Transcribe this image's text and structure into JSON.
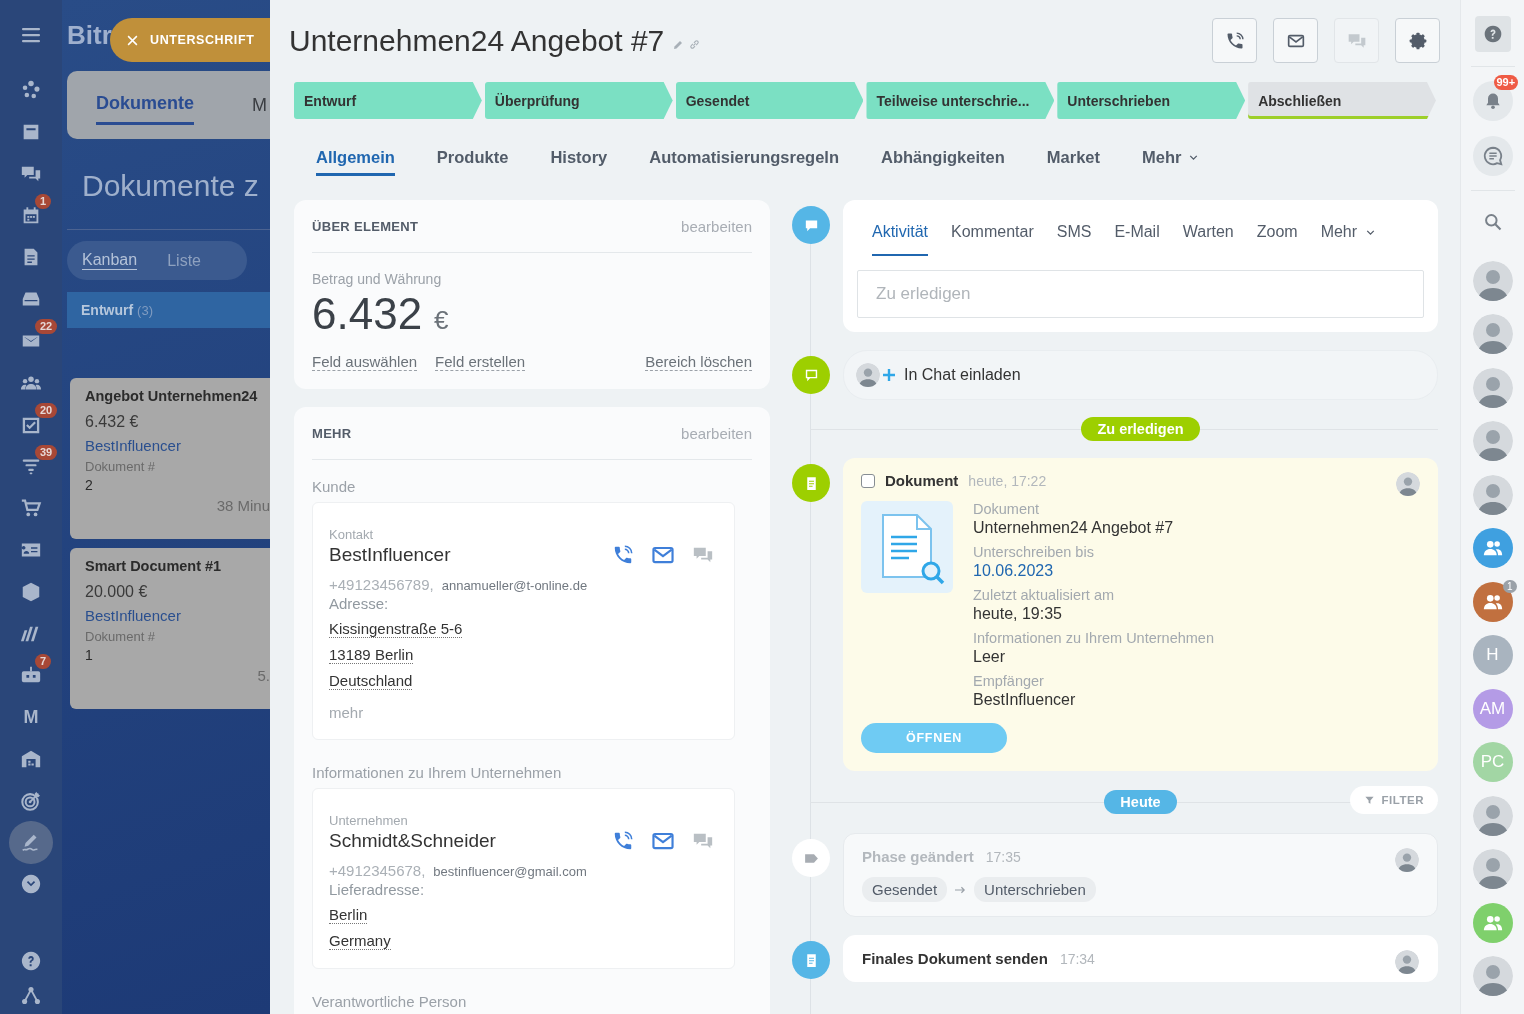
{
  "nav": {
    "items": [
      {
        "selected": false
      },
      {
        "selected": false
      },
      {
        "selected": false
      },
      {
        "badge": "1",
        "selected": false
      },
      {
        "selected": false
      },
      {
        "selected": false
      },
      {
        "badge": "22",
        "selected": false
      },
      {
        "selected": false
      },
      {
        "badge": "20",
        "selected": false
      },
      {
        "badge": "39",
        "selected": false
      },
      {
        "selected": false
      },
      {
        "selected": false
      },
      {
        "selected": false
      },
      {
        "selected": false
      },
      {
        "badge": "7",
        "selected": false
      },
      {
        "label": "M",
        "selected": false
      },
      {
        "selected": false
      },
      {
        "selected": false
      },
      {
        "selected": true
      },
      {
        "selected": false
      }
    ]
  },
  "background": {
    "logo": "Bitr",
    "tabs": [
      {
        "label": "Dokumente",
        "selected": true
      },
      {
        "label": "M",
        "selected": false
      }
    ],
    "title": "Dokumente z",
    "views": [
      {
        "label": "Kanban",
        "selected": true
      },
      {
        "label": "Liste",
        "selected": false
      }
    ],
    "column": {
      "name": "Entwurf",
      "count": "(3)"
    },
    "cards": [
      {
        "title": "Angebot Unternehmen24",
        "amount": "6.432 €",
        "client": "BestInfluencer",
        "field_label": "Dokument #",
        "field_value": "2",
        "time": "38 Minu"
      },
      {
        "title": "Smart Document #1",
        "amount": "20.000 €",
        "client": "BestInfluencer",
        "field_label": "Dokument #",
        "field_value": "1",
        "time": "5."
      }
    ]
  },
  "close_tab": {
    "label": "UNTERSCHRIFT"
  },
  "slider": {
    "title": "Unternehmen24 Angebot #7",
    "header_buttons": [
      {
        "disabled": false
      },
      {
        "disabled": false
      },
      {
        "disabled": true
      },
      {
        "disabled": false
      }
    ],
    "stages": [
      {
        "label": "Entwurf",
        "reached": true
      },
      {
        "label": "Überprüfung",
        "reached": true
      },
      {
        "label": "Gesendet",
        "reached": true
      },
      {
        "label": "Teilweise unterschrie...",
        "reached": true
      },
      {
        "label": "Unterschrieben",
        "reached": true
      },
      {
        "label": "Abschließen",
        "reached": false
      }
    ],
    "tabs": [
      {
        "label": "Allgemein",
        "selected": true,
        "menu": false
      },
      {
        "label": "Produkte",
        "selected": false,
        "menu": false
      },
      {
        "label": "History",
        "selected": false,
        "menu": false
      },
      {
        "label": "Automatisierungsregeln",
        "selected": false,
        "menu": false
      },
      {
        "label": "Abhängigkeiten",
        "selected": false,
        "menu": false
      },
      {
        "label": "Market",
        "selected": false,
        "menu": false
      },
      {
        "label": "Mehr",
        "selected": false,
        "menu": true
      }
    ],
    "about": {
      "heading": "ÜBER ELEMENT",
      "edit": "bearbeiten",
      "amount_label": "Betrag und Währung",
      "amount": "6.432",
      "currency": "€",
      "links": [
        "Feld auswählen",
        "Feld erstellen"
      ],
      "clear": "Bereich löschen"
    },
    "more": {
      "heading": "MEHR",
      "edit": "bearbeiten",
      "sections": [
        {
          "label": "Kunde",
          "entity": {
            "type": "Kontakt",
            "name": "BestInfluencer",
            "phone": "+49123456789,",
            "email": "annamueller@t-online.de",
            "address_label": "Adresse:",
            "address": [
              "Kissingenstraße 5-6",
              "13189 Berlin",
              "Deutschland"
            ],
            "more": "mehr"
          }
        },
        {
          "label": "Informationen zu Ihrem Unternehmen",
          "entity": {
            "type": "Unternehmen",
            "name": "Schmidt&Schneider",
            "phone": "+4912345678,",
            "email": "bestinfluencer@gmail.com",
            "address_label": "Lieferadresse:",
            "address": [
              "Berlin",
              "Germany"
            ]
          }
        },
        {
          "label": "Verantwortliche Person"
        }
      ]
    },
    "activity": {
      "tabs": [
        {
          "label": "Aktivität",
          "selected": true,
          "menu": false
        },
        {
          "label": "Kommentar",
          "selected": false,
          "menu": false
        },
        {
          "label": "SMS",
          "selected": false,
          "menu": false
        },
        {
          "label": "E-Mail",
          "selected": false,
          "menu": false
        },
        {
          "label": "Warten",
          "selected": false,
          "menu": false
        },
        {
          "label": "Zoom",
          "selected": false,
          "menu": false
        },
        {
          "label": "Mehr",
          "selected": false,
          "menu": true
        }
      ],
      "placeholder": "Zu erledigen"
    },
    "invite": {
      "label": "In Chat einladen"
    },
    "todo_divider": "Zu erledigen",
    "document_task": {
      "checked": false,
      "title": "Dokument",
      "time": "heute, 17:22",
      "fields": [
        {
          "label": "Dokument",
          "value": "Unternehmen24 Angebot #7",
          "link": false
        },
        {
          "label": "Unterschreiben bis",
          "value": "10.06.2023",
          "link": true
        },
        {
          "label": "Zuletzt aktualisiert am",
          "value": "heute, 19:35",
          "link": false
        },
        {
          "label": "Informationen zu Ihrem Unternehmen",
          "value": "Leer",
          "link": false
        },
        {
          "label": "Empfänger",
          "value": "BestInfluencer",
          "link": false
        }
      ],
      "button": "ÖFFNEN"
    },
    "today_divider": "Heute",
    "filter": "FILTER",
    "history": [
      {
        "kind": "stage_change",
        "title": "Phase geändert",
        "time": "17:35",
        "from": "Gesendet",
        "to": "Unterschrieben"
      },
      {
        "kind": "document",
        "title": "Finales Dokument senden",
        "time": "17:34"
      }
    ]
  },
  "rail": {
    "notifications_badge": "99+",
    "contacts": [
      {
        "kind": "photo"
      },
      {
        "kind": "photo"
      },
      {
        "kind": "photo"
      },
      {
        "kind": "photo"
      },
      {
        "kind": "photo"
      },
      {
        "kind": "group",
        "color": "#3fa0e0"
      },
      {
        "kind": "group",
        "color": "#c1703f",
        "badge": "1"
      },
      {
        "kind": "initials",
        "label": "H",
        "color": "#a9b4bf"
      },
      {
        "kind": "initials",
        "label": "AM",
        "color": "#b49be6"
      },
      {
        "kind": "initials",
        "label": "PC",
        "color": "#a2d6a4"
      },
      {
        "kind": "photo"
      },
      {
        "kind": "photo"
      },
      {
        "kind": "group",
        "color": "#7fd06c"
      },
      {
        "kind": "photo"
      }
    ]
  }
}
